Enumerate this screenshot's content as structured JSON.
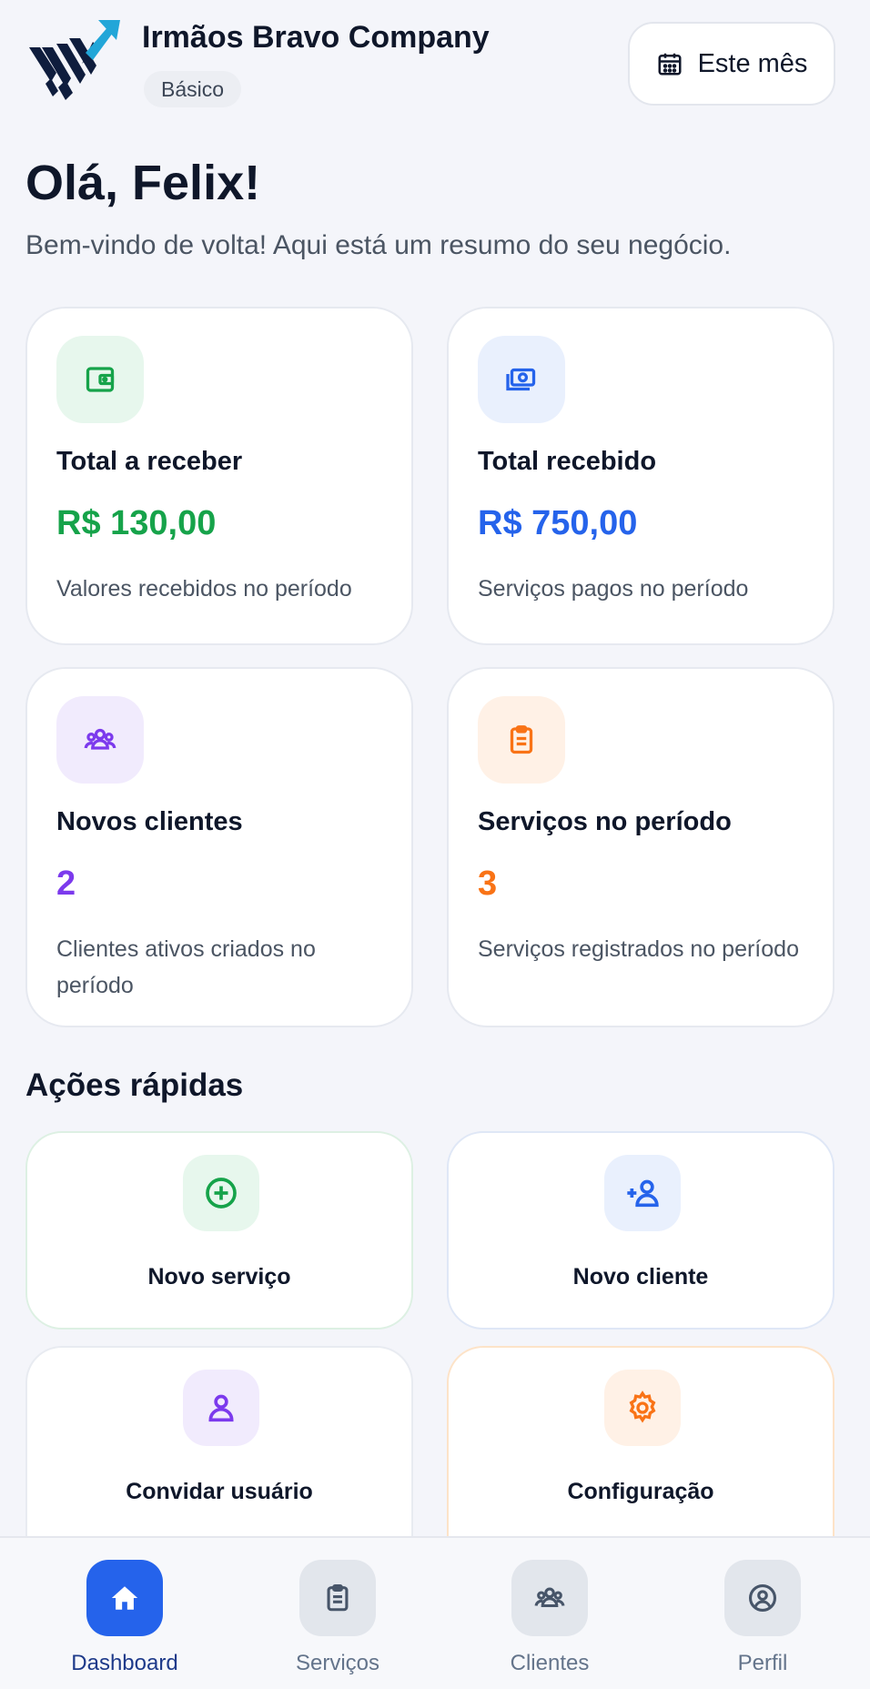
{
  "header": {
    "company_name": "Irmãos Bravo Company",
    "plan": "Básico",
    "period_button": {
      "label": "Este mês",
      "icon": "calendar-icon"
    }
  },
  "greeting": {
    "title": "Olá, Felix!",
    "subtitle": "Bem-vindo de volta! Aqui está um resumo do seu negócio."
  },
  "stats": [
    {
      "title": "Total a receber",
      "value": "R$ 130,00",
      "description": "Valores recebidos no período",
      "icon": "wallet-icon",
      "color": "#16a34a",
      "icon_bg": "#e7f7ed"
    },
    {
      "title": "Total recebido",
      "value": "R$ 750,00",
      "description": "Serviços pagos no período",
      "icon": "money-icon",
      "color": "#2563eb",
      "icon_bg": "#e9f0fd"
    },
    {
      "title": "Novos clientes",
      "value": "2",
      "description": "Clientes ativos criados no período",
      "icon": "users-icon",
      "color": "#7c3aed",
      "icon_bg": "#f1ebfd"
    },
    {
      "title": "Serviços no período",
      "value": "3",
      "description": "Serviços registrados no período",
      "icon": "clipboard-icon",
      "color": "#f97316",
      "icon_bg": "#fff1e6"
    }
  ],
  "quick_actions": {
    "title": "Ações rápidas",
    "items": [
      {
        "label": "Novo serviço",
        "icon": "plus-circle-icon",
        "color": "#16a34a",
        "icon_bg": "#e7f7ed"
      },
      {
        "label": "Novo cliente",
        "icon": "user-plus-icon",
        "color": "#2563eb",
        "icon_bg": "#e9f0fd"
      },
      {
        "label": "Convidar usuário",
        "icon": "user-icon",
        "color": "#7c3aed",
        "icon_bg": "#f1ebfd"
      },
      {
        "label": "Configuração",
        "icon": "gear-icon",
        "color": "#f97316",
        "icon_bg": "#fff1e6"
      }
    ]
  },
  "bottom_nav": {
    "items": [
      {
        "label": "Dashboard",
        "icon": "home-icon",
        "active": true
      },
      {
        "label": "Serviços",
        "icon": "clipboard-icon",
        "active": false
      },
      {
        "label": "Clientes",
        "icon": "users-icon",
        "active": false
      },
      {
        "label": "Perfil",
        "icon": "user-circle-icon",
        "active": false
      }
    ]
  },
  "colors": {
    "accent": "#2563eb",
    "background": "#f4f5fa",
    "text": "#0f172a",
    "muted": "#4b5563"
  }
}
